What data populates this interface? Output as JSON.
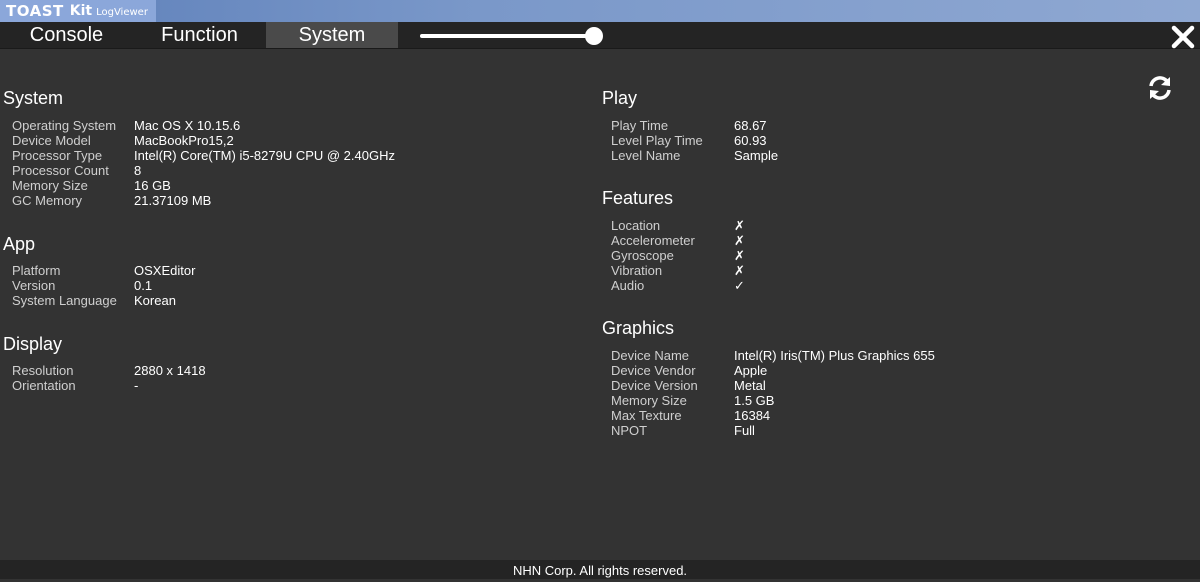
{
  "app": {
    "logo_main": "TOAST",
    "logo_kit": "Kit",
    "logo_sub": "LogViewer"
  },
  "tabs": [
    {
      "label": "Console",
      "active": false
    },
    {
      "label": "Function",
      "active": false
    },
    {
      "label": "System",
      "active": true
    }
  ],
  "zoom_slider": {
    "value_fraction": 0.96
  },
  "system": {
    "title": "System",
    "rows": [
      {
        "label": "Operating System",
        "value": "Mac OS X 10.15.6"
      },
      {
        "label": "Device Model",
        "value": "MacBookPro15,2"
      },
      {
        "label": "Processor Type",
        "value": "Intel(R) Core(TM) i5-8279U CPU @ 2.40GHz"
      },
      {
        "label": "Processor Count",
        "value": "8"
      },
      {
        "label": "Memory Size",
        "value": "16 GB"
      },
      {
        "label": "GC Memory",
        "value": "21.37109 MB"
      }
    ]
  },
  "app_info": {
    "title": "App",
    "rows": [
      {
        "label": "Platform",
        "value": "OSXEditor"
      },
      {
        "label": "Version",
        "value": "0.1"
      },
      {
        "label": "System Language",
        "value": "Korean"
      }
    ]
  },
  "display": {
    "title": "Display",
    "rows": [
      {
        "label": "Resolution",
        "value": "2880 x 1418"
      },
      {
        "label": "Orientation",
        "value": "-"
      }
    ]
  },
  "play": {
    "title": "Play",
    "rows": [
      {
        "label": "Play Time",
        "value": "68.67"
      },
      {
        "label": "Level Play Time",
        "value": "60.93"
      },
      {
        "label": "Level Name",
        "value": "Sample"
      }
    ]
  },
  "features": {
    "title": "Features",
    "rows": [
      {
        "label": "Location",
        "value": "✗"
      },
      {
        "label": "Accelerometer",
        "value": "✗"
      },
      {
        "label": "Gyroscope",
        "value": "✗"
      },
      {
        "label": "Vibration",
        "value": "✗"
      },
      {
        "label": "Audio",
        "value": "✓"
      }
    ]
  },
  "graphics": {
    "title": "Graphics",
    "rows": [
      {
        "label": "Device Name",
        "value": "Intel(R) Iris(TM) Plus Graphics 655"
      },
      {
        "label": "Device Vendor",
        "value": "Apple"
      },
      {
        "label": "Device Version",
        "value": "Metal"
      },
      {
        "label": "Memory Size",
        "value": "1.5 GB"
      },
      {
        "label": "Max Texture",
        "value": "16384"
      },
      {
        "label": "NPOT",
        "value": "Full"
      }
    ]
  },
  "icons": {
    "close": "close-icon",
    "refresh": "refresh-icon"
  },
  "footer": {
    "text": "NHN Corp. All rights reserved."
  }
}
